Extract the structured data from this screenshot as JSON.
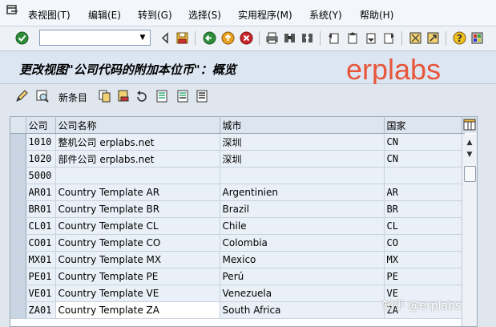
{
  "menu": {
    "items": [
      "表视图(T)",
      "编辑(E)",
      "转到(G)",
      "选择(S)",
      "实用程序(M)",
      "系统(Y)",
      "帮助(H)"
    ]
  },
  "toolbar": {
    "command_value": "",
    "icons": [
      "enter-icon",
      "back-icon",
      "exit-icon",
      "cancel-icon",
      "print-icon",
      "find-icon",
      "find-next-icon",
      "first-page-icon",
      "prev-page-icon",
      "next-page-icon",
      "last-page-icon",
      "layout-icon",
      "new-session-icon",
      "help-icon",
      "customize-icon"
    ]
  },
  "title": "更改视图\"公司代码的附加本位币\"：概览",
  "watermark": "erplabs",
  "app_toolbar": {
    "new_entries_label": "新条目"
  },
  "table": {
    "columns": [
      "公司",
      "公司名称",
      "城市",
      "国家"
    ],
    "rows": [
      {
        "code": "1010",
        "name": "整机公司 erplabs.net",
        "city": "深圳",
        "country": "CN"
      },
      {
        "code": "1020",
        "name": "部件公司 erplabs.net",
        "city": "深圳",
        "country": "CN"
      },
      {
        "code": "5000",
        "name": "",
        "city": "",
        "country": ""
      },
      {
        "code": "AR01",
        "name": "Country Template AR",
        "city": "Argentinien",
        "country": "AR"
      },
      {
        "code": "BR01",
        "name": "Country Template BR",
        "city": "Brazil",
        "country": "BR"
      },
      {
        "code": "CL01",
        "name": "Country Template CL",
        "city": "Chile",
        "country": "CL"
      },
      {
        "code": "CO01",
        "name": "Country Template CO",
        "city": "Colombia",
        "country": "CO"
      },
      {
        "code": "MX01",
        "name": "Country Template MX",
        "city": "Mexico",
        "country": "MX"
      },
      {
        "code": "PE01",
        "name": "Country Template PE",
        "city": "Perú",
        "country": "PE"
      },
      {
        "code": "VE01",
        "name": "Country Template VE",
        "city": "Venezuela",
        "country": "VE"
      },
      {
        "code": "ZA01",
        "name": "Country Template ZA",
        "city": "South Africa",
        "country": "ZA"
      }
    ]
  },
  "footer_watermark": "知乎 @erplabs"
}
